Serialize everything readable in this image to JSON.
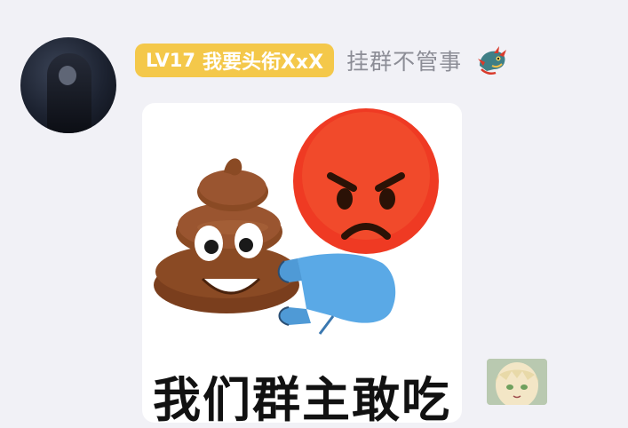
{
  "message": {
    "level_label": "LV17",
    "title_label": "我要头衔XxX",
    "nickname": "挂群不管事",
    "sticker_caption": "我们群主敢吃"
  },
  "icons": {
    "sender_avatar": "avatar-dark-figure",
    "nickname_badge": "dragon-icon",
    "sticker_poop": "poop-emoji",
    "sticker_angry": "angry-face-emoji",
    "read_receipt": "anime-girl-avatar"
  },
  "colors": {
    "background": "#f1f1f6",
    "level_badge": "#f4c84a",
    "nickname_text": "#8c8d96",
    "angry_face": "#ef3a23",
    "arm_blue": "#5aa9e6",
    "poop_brown": "#8a4a24"
  }
}
